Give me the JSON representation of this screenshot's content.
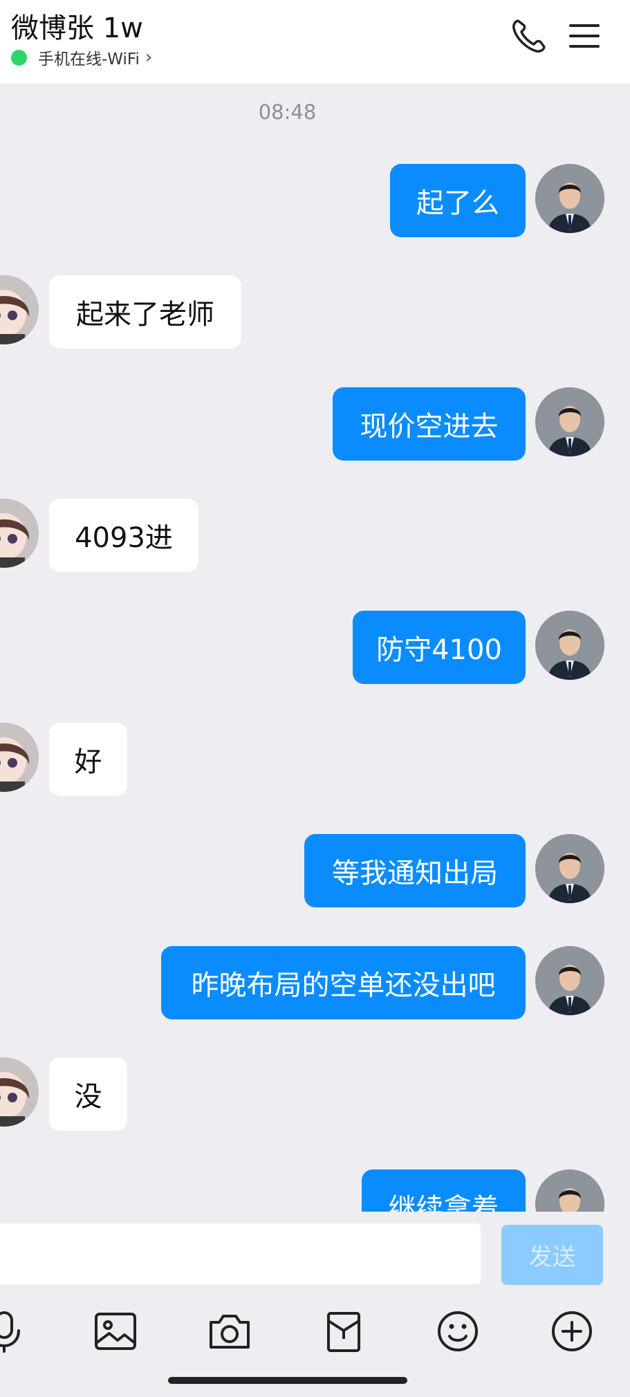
{
  "header": {
    "title": "微博张 1w",
    "status": "手机在线-WiFi",
    "status_color": "#2BD66B",
    "icons": [
      "phone-icon",
      "menu-icon"
    ]
  },
  "chat": {
    "timestamp": "08:48",
    "colors": {
      "outgoing": "#0A8CFF",
      "incoming": "#FFFFFF",
      "background": "#EDEDF2"
    },
    "messages": [
      {
        "from": "me",
        "text": "起了么"
      },
      {
        "from": "other",
        "text": "起来了老师"
      },
      {
        "from": "me",
        "text": "现价空进去"
      },
      {
        "from": "other",
        "text": "4093进"
      },
      {
        "from": "me",
        "text": "防守4100"
      },
      {
        "from": "other",
        "text": "好"
      },
      {
        "from": "me",
        "text": "等我通知出局"
      },
      {
        "from": "me",
        "text": "昨晚布局的空单还没出吧"
      },
      {
        "from": "other",
        "text": "没"
      },
      {
        "from": "me",
        "text": "继续拿着"
      }
    ]
  },
  "input": {
    "value": "",
    "send_label": "发送",
    "tools": [
      "microphone-icon",
      "image-icon",
      "camera-icon",
      "red-packet-icon",
      "emoji-icon",
      "plus-icon"
    ]
  }
}
